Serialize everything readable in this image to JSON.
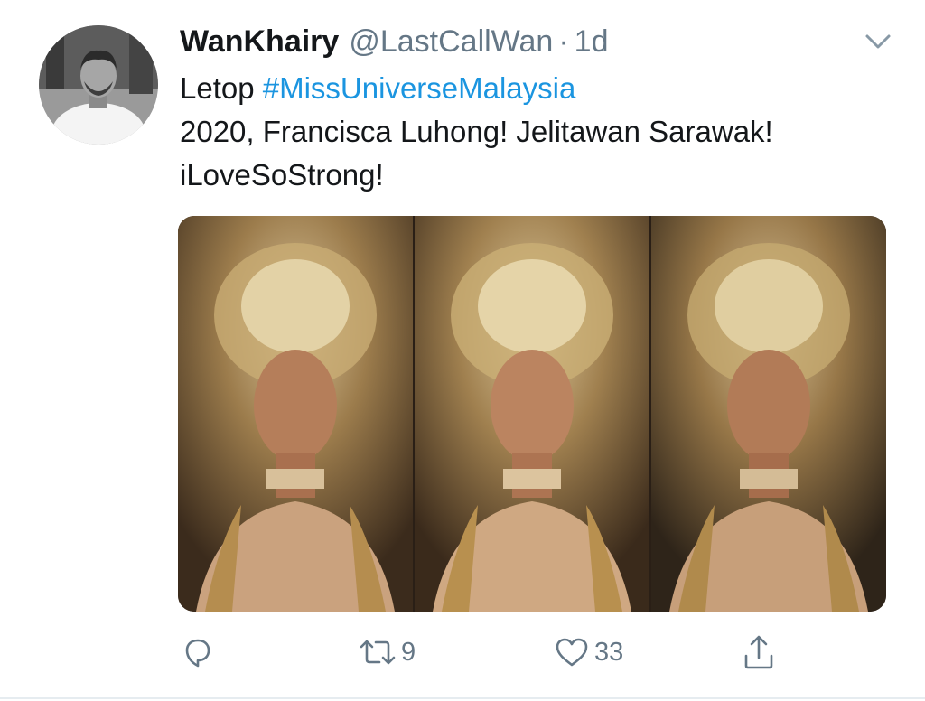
{
  "tweet": {
    "author": {
      "display_name": "WanKhairy",
      "handle": "@LastCallWan",
      "separator": "·",
      "time": "1d"
    },
    "text": {
      "line1_prefix": "Letop ",
      "hashtag": "#MissUniverseMalaysia",
      "line2": "2020, Francisca Luhong! Jelitawan Sarawak!",
      "line3": "iLoveSoStrong!"
    },
    "media": {
      "photos": [
        {
          "description_icon": "photo"
        },
        {
          "description_icon": "photo"
        },
        {
          "description_icon": "photo"
        }
      ]
    },
    "actions": {
      "reply_icon": "reply-icon",
      "retweet_icon": "retweet-icon",
      "retweet_count": "9",
      "like_icon": "heart-icon",
      "like_count": "33",
      "share_icon": "share-icon"
    }
  },
  "colors": {
    "text_primary": "#14171a",
    "text_secondary": "#657786",
    "link": "#1b95e0",
    "divider": "#e6ecf0"
  }
}
